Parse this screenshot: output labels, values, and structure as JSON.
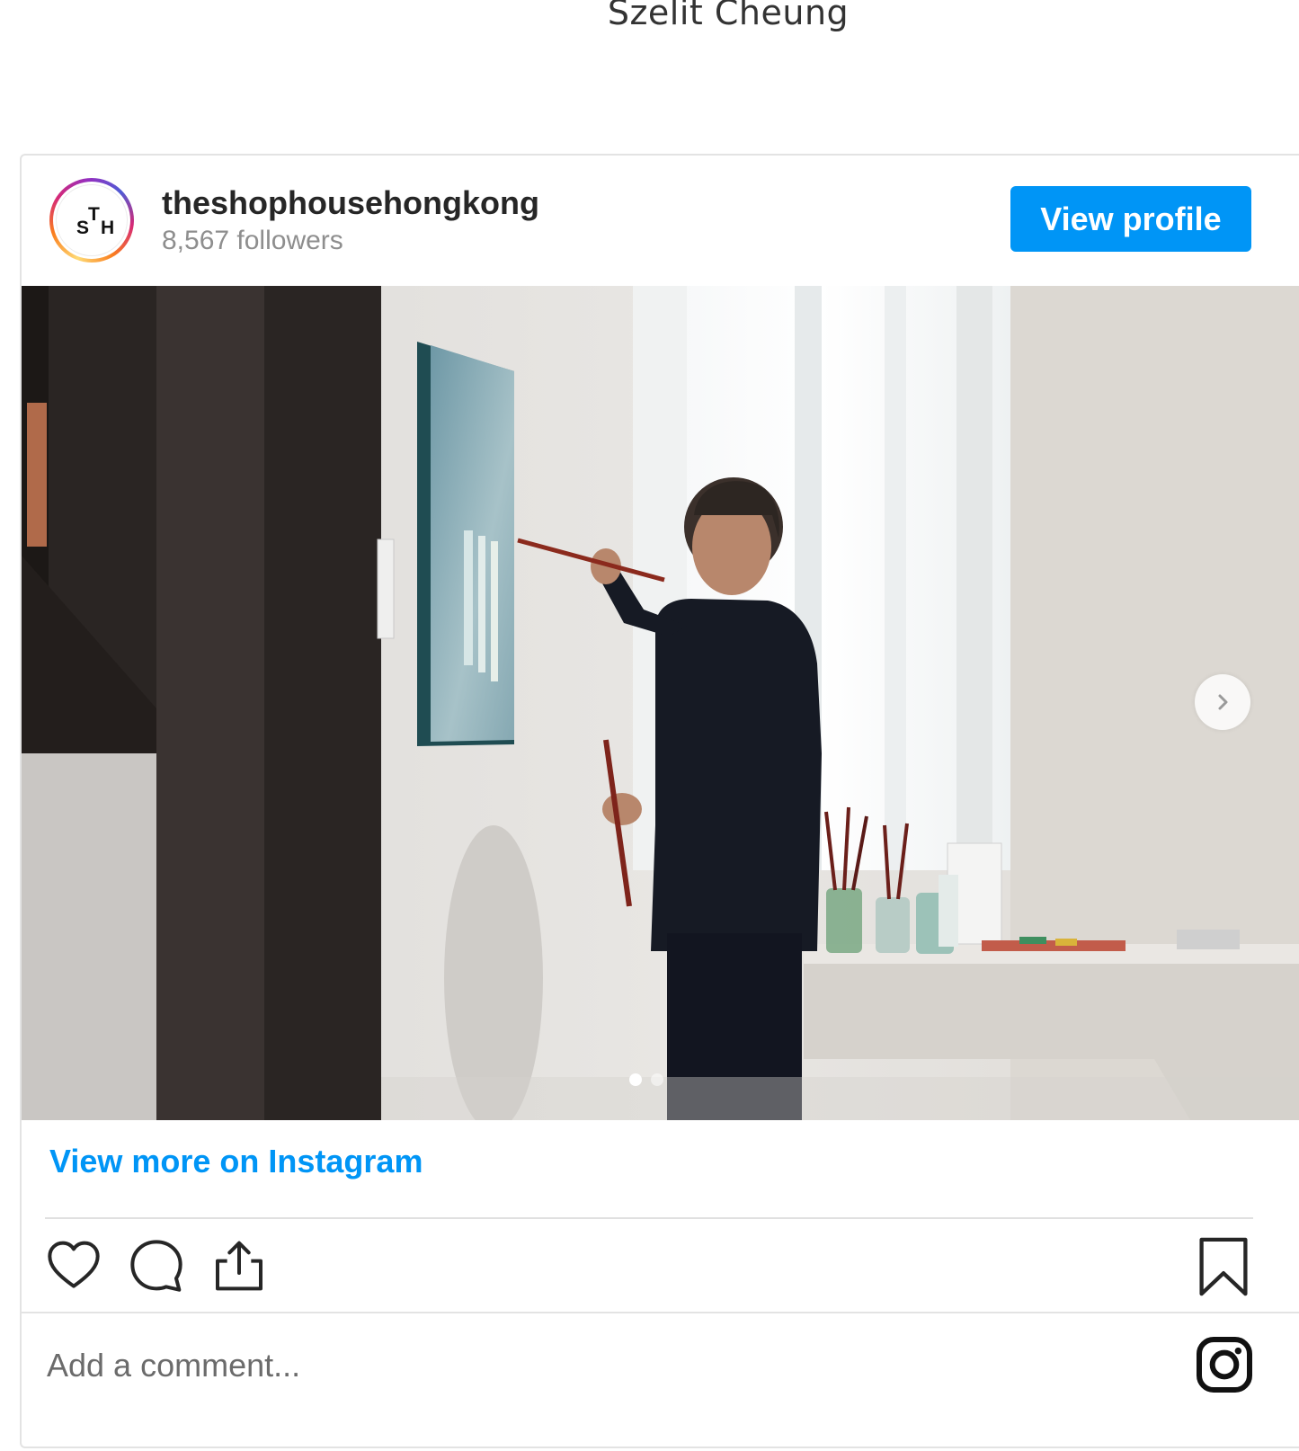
{
  "page": {
    "caption": "Szelit Cheung"
  },
  "embed": {
    "header": {
      "username": "theshophousehongkong",
      "followers": "8,567 followers",
      "view_profile_label": "View profile",
      "avatar": {
        "letters": [
          "S",
          "T",
          "H"
        ]
      }
    },
    "media": {
      "carousel_count": 2,
      "active_index": 0,
      "next_icon": "chevron-right-icon"
    },
    "view_more_label": "View more on Instagram",
    "actions": {
      "like_icon": "heart-icon",
      "comment_icon": "comment-icon",
      "share_icon": "share-icon",
      "save_icon": "bookmark-icon"
    },
    "comment": {
      "placeholder": "Add a comment..."
    },
    "brand": {
      "logo_icon": "instagram-icon",
      "accent_color": "#0095f6"
    }
  }
}
